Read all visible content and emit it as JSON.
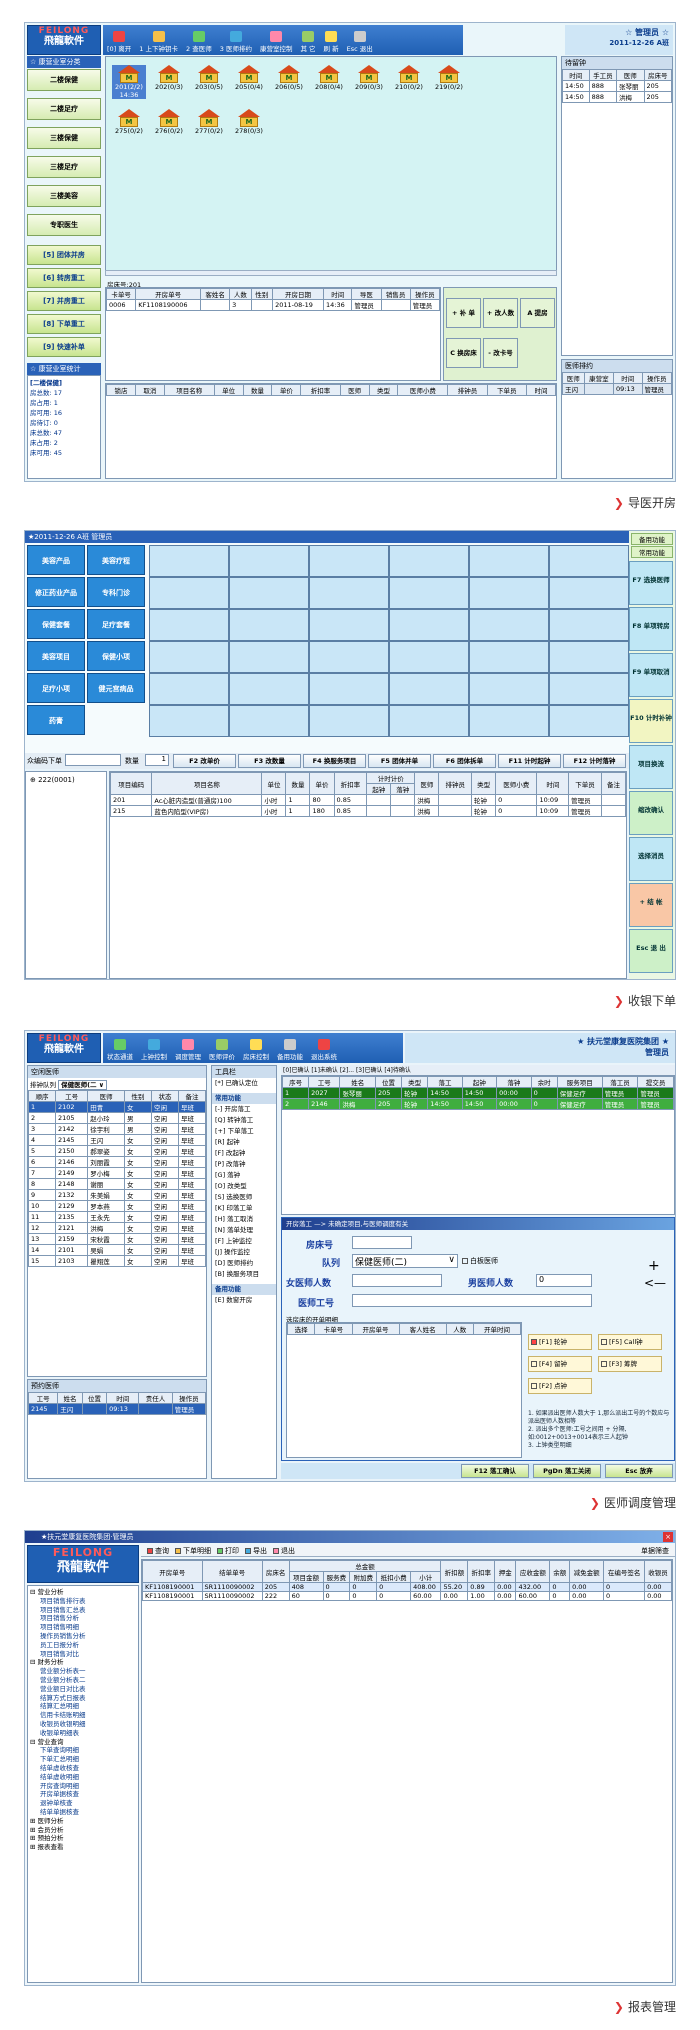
{
  "captions": {
    "p1": "导医开房",
    "p2": "收银下单",
    "p3": "医师调度管理",
    "p4": "报表管理"
  },
  "logo": {
    "en": "FEILONG",
    "cn": "飛龍軟件"
  },
  "p1": {
    "toolbar": [
      {
        "key": "[0]",
        "label": "离开"
      },
      {
        "key": "1",
        "label": "上下钟钥卡"
      },
      {
        "key": "2",
        "label": "查医师"
      },
      {
        "key": "3",
        "label": "医师排约"
      },
      {
        "key": "",
        "label": "康营室控制"
      },
      {
        "key": "",
        "label": "其 它"
      },
      {
        "key": "",
        "label": "刷 新"
      },
      {
        "key": "Esc",
        "label": "退出"
      }
    ],
    "user": "☆ 管理员 ☆",
    "date": "2011-12-26",
    "shift": "A班",
    "sidebar_title": "☆ 康营业室分类",
    "sidebar_items": [
      "二楼保健",
      "二楼足疗",
      "三楼保健",
      "三楼足疗",
      "三楼美容",
      "专职医生"
    ],
    "func_items": [
      "[5] 团体并房",
      "[6] 转房重工",
      "[7] 并房重工",
      "[8] 下单重工",
      "[9] 快速补单"
    ],
    "stats_title": "☆ 康营业室统计",
    "stats_group": "[二楼保健]",
    "stats": [
      {
        "k": "房总数",
        "v": "17"
      },
      {
        "k": "房占用",
        "v": "1"
      },
      {
        "k": "房可用",
        "v": "16"
      },
      {
        "k": "房待订",
        "v": "0"
      },
      {
        "k": "床总数",
        "v": "47"
      },
      {
        "k": "床占用",
        "v": "2"
      },
      {
        "k": "床可用",
        "v": "45"
      }
    ],
    "rooms": [
      {
        "no": "201",
        "cnt": "(2/2)",
        "t": "14:36"
      },
      {
        "no": "202",
        "cnt": "(0/3)"
      },
      {
        "no": "203",
        "cnt": "(0/5)"
      },
      {
        "no": "205",
        "cnt": "(0/4)"
      },
      {
        "no": "206",
        "cnt": "(0/5)"
      },
      {
        "no": "208",
        "cnt": "(0/4)"
      },
      {
        "no": "209",
        "cnt": "(0/3)"
      },
      {
        "no": "210",
        "cnt": "(0/2)"
      },
      {
        "no": "219",
        "cnt": "(0/2)"
      },
      {
        "no": "275",
        "cnt": "(0/2)"
      },
      {
        "no": "276",
        "cnt": "(0/2)"
      },
      {
        "no": "277",
        "cnt": "(0/2)"
      },
      {
        "no": "278",
        "cnt": "(0/3)"
      }
    ],
    "room_info": "房床号:201",
    "card_cols": [
      "卡单号",
      "开房单号",
      "客姓名",
      "人数",
      "性别",
      "开房日期",
      "时间",
      "导医",
      "销售员",
      "操作员"
    ],
    "card_row": [
      "0006",
      "KF1108190006",
      "",
      "3",
      "",
      "2011-08-19",
      "14:36",
      "管理员",
      "",
      "管理员"
    ],
    "card_btns": [
      "+ 补 单",
      "+ 改人数",
      "A 提房",
      "C 换房床",
      "- 改卡号"
    ],
    "item_cols": [
      "锁店",
      "取消",
      "项目名称",
      "单位",
      "数量",
      "单价",
      "折扣率",
      "医师",
      "类型",
      "医师小费",
      "排钟员",
      "下单员",
      "时间"
    ],
    "wait_title": "待留钟",
    "wait_cols": [
      "时间",
      "手工员",
      "医师",
      "房床号"
    ],
    "wait_rows": [
      [
        "14:50",
        "888",
        "张琴丽",
        "205"
      ],
      [
        "14:50",
        "888",
        "洪梅",
        "205"
      ]
    ],
    "doc_title": "医师排约",
    "doc_cols": [
      "医师",
      "康营室",
      "时间",
      "操作员"
    ],
    "doc_rows": [
      [
        "王闪",
        "",
        "09:13",
        "管理员"
      ]
    ]
  },
  "p2": {
    "header": "★2011-12-26 A班 管理员",
    "cats": [
      "美容产品",
      "美容疗程",
      "修正药业产品",
      "专科门诊",
      "保健套餐",
      "足疗套餐",
      "美容项目",
      "保健小项",
      "足疗小项",
      "健元宫病品",
      "药膏"
    ],
    "right_top": [
      "备用功能",
      "常用功能"
    ],
    "right_btns": [
      "F7 选换医师",
      "F8 单项转房",
      "F9 单项取消",
      "F10 计时补钟",
      "项目换流",
      "缩改确认",
      "选择消员",
      "+ 结 帐",
      "Esc 退 出"
    ],
    "qty_label": "数量",
    "qty": "1",
    "order_label": "众编码下单",
    "fkeys": [
      "F2 改单价",
      "F3 改数量",
      "F4 换服务项目",
      "F5 团体并单",
      "F6 团体拆单",
      "F11 计时起钟",
      "F12 计时落钟"
    ],
    "tree_root": "⊕ 222(0001)",
    "cols": [
      "项目编码",
      "项目名称",
      "单位",
      "数量",
      "单价",
      "折扣率",
      "起钟",
      "落钟",
      "医师",
      "排钟员",
      "类型",
      "医师小费",
      "时间",
      "下单员",
      "备注"
    ],
    "timing": "计时计价",
    "rows": [
      [
        "201",
        "Ac心脏内造型(普通房)100",
        "小时",
        "1",
        "80",
        "0.85",
        "",
        "",
        "洪梅",
        "",
        "轮钟",
        "0",
        "10:09",
        "管理员",
        ""
      ],
      [
        "215",
        "蓝色内陷型(VIP房)",
        "小时",
        "1",
        "180",
        "0.85",
        "",
        "",
        "洪梅",
        "",
        "轮钟",
        "0",
        "10:09",
        "管理员",
        ""
      ]
    ]
  },
  "p3": {
    "toolbar": [
      "状态通道",
      "上钟控制",
      "调度管理",
      "医师评价",
      "房床控制",
      "备用功能",
      "退出系统"
    ],
    "company": "★ 扶元堂康复医院集团 ★",
    "user": "管理员",
    "left_title": "空闲医师",
    "sort_label": "排钟队列",
    "queue": "保健医师(二 ∨",
    "left_cols": [
      "顺序",
      "工号",
      "医师",
      "性别",
      "状态",
      "备注"
    ],
    "left_rows": [
      [
        "1",
        "2102",
        "田青",
        "女",
        "空闲",
        "早班"
      ],
      [
        "2",
        "2105",
        "赵小玲",
        "男",
        "空闲",
        "早班"
      ],
      [
        "3",
        "2142",
        "徐宇利",
        "男",
        "空闲",
        "早班"
      ],
      [
        "4",
        "2145",
        "王闪",
        "女",
        "空闲",
        "早班"
      ],
      [
        "5",
        "2150",
        "郝翠姿",
        "女",
        "空闲",
        "早班"
      ],
      [
        "6",
        "2146",
        "刘丽霞",
        "女",
        "空闲",
        "早班"
      ],
      [
        "7",
        "2149",
        "罗小梅",
        "女",
        "空闲",
        "早班"
      ],
      [
        "8",
        "2148",
        "谢丽",
        "女",
        "空闲",
        "早班"
      ],
      [
        "9",
        "2132",
        "朱美娟",
        "女",
        "空闲",
        "早班"
      ],
      [
        "10",
        "2129",
        "罗本燕",
        "女",
        "空闲",
        "早班"
      ],
      [
        "11",
        "2135",
        "王永先",
        "女",
        "空闲",
        "早班"
      ],
      [
        "12",
        "2121",
        "洪梅",
        "女",
        "空闲",
        "早班"
      ],
      [
        "13",
        "2159",
        "宋秋霞",
        "女",
        "空闲",
        "早班"
      ],
      [
        "14",
        "2101",
        "吴娟",
        "女",
        "空闲",
        "早班"
      ],
      [
        "15",
        "2103",
        "瞿翔莲",
        "女",
        "空闲",
        "早班"
      ]
    ],
    "book_title": "预约医师",
    "book_cols": [
      "工号",
      "姓名",
      "位置",
      "时间",
      "责任人",
      "操作员"
    ],
    "book_rows": [
      [
        "2145",
        "王闪",
        "",
        "09:13",
        "",
        "管理员"
      ]
    ],
    "mid_title": "工具栏",
    "mid_items": [
      "[*] 已确认定位",
      "常用功能",
      "[-] 开房落工",
      "[Q] 转钟落工",
      "[+] 下单落工",
      "[R] 起钟",
      "[F] 改起钟",
      "[P] 改落钟",
      "[G] 落钟",
      "[O] 改类型",
      "[S] 选换医师",
      "[K] 印落工单",
      "[H] 落工取消",
      "[N] 落单处理",
      "[F] 上钟监控",
      "[J] 操作监控",
      "[D] 医师排约",
      "[B] 换服务项目",
      "备用功能",
      "[E] 数窗开房"
    ],
    "status_tabs": "[0]已确认  [1]未确认  [2]...  [3]已确认  [4]待确认",
    "busy_cols": [
      "序号",
      "工号",
      "姓名",
      "位置",
      "类型",
      "落工",
      "起钟",
      "落钟",
      "余时",
      "服务项目",
      "落工员",
      "提交员"
    ],
    "busy_rows": [
      [
        "1",
        "2027",
        "张琴丽",
        "205",
        "轮钟",
        "14:50",
        "14:50",
        "00:00",
        "0",
        "保健足疗",
        "管理员",
        "管理员"
      ],
      [
        "2",
        "2146",
        "洪梅",
        "205",
        "轮钟",
        "14:50",
        "14:50",
        "00:00",
        "0",
        "保健足疗",
        "管理员",
        "管理员"
      ]
    ],
    "dialog_title": "开房落工 —> 未确定项目,与医师调度有关",
    "room_label": "房床号",
    "queue_label": "队列",
    "queue_val": "保健医师(二)",
    "queue_opt": "白板医师",
    "female_label": "女医师人数",
    "male_label": "男医师人数",
    "male_val": "0",
    "worker_label": "医师工号",
    "list_title": "选房床的开单明细",
    "list_cols": [
      "选择",
      "卡单号",
      "开房单号",
      "客人姓名",
      "人数",
      "开单时间"
    ],
    "checks": [
      "[F1] 轮钟",
      "[F4] 留钟",
      "[F2] 点钟",
      "[F5] Call钟",
      "[F3] 筹牌"
    ],
    "notes": [
      "1. 如果派出医师人数大于 1,那么派出工号的个数应与派出医师人数相等",
      "2. 派出多个医师:工号之间用 + 分隔,如:0012+0013+0014表示三人起钟",
      "3. 上钟类型明细"
    ],
    "bottom_btns": [
      "F12 落工确认",
      "PgDn 落工关闭",
      "Esc 放弃"
    ]
  },
  "p4": {
    "title": "★扶元堂康复医院集团·管理员",
    "toolbar": [
      "查询",
      "下单明细",
      "打印",
      "导出",
      "退出"
    ],
    "filter": "单据筛查",
    "tree": [
      {
        "t": "⊟ 营业分析",
        "l": 0
      },
      {
        "t": "项目销售排行表",
        "l": 1
      },
      {
        "t": "项目销售汇总表",
        "l": 1
      },
      {
        "t": "项目销售分析",
        "l": 1
      },
      {
        "t": "项目销售明细",
        "l": 1
      },
      {
        "t": "操作员销售分析",
        "l": 1
      },
      {
        "t": "员工日报分析",
        "l": 1
      },
      {
        "t": "项目销售对比",
        "l": 1
      },
      {
        "t": "⊟ 财务分析",
        "l": 0
      },
      {
        "t": "营业额分析表一",
        "l": 1
      },
      {
        "t": "营业额分析表二",
        "l": 1
      },
      {
        "t": "营业额日对比表",
        "l": 1
      },
      {
        "t": "结算方式日报表",
        "l": 1
      },
      {
        "t": "结算汇总明细",
        "l": 1
      },
      {
        "t": "信用卡结账明细",
        "l": 1
      },
      {
        "t": "收银员收银明细",
        "l": 1
      },
      {
        "t": "收银单明细表",
        "l": 1
      },
      {
        "t": "⊟ 营业查询",
        "l": 0
      },
      {
        "t": "下单查询明细",
        "l": 1
      },
      {
        "t": "下单汇总明细",
        "l": 1
      },
      {
        "t": "结单虚收核查",
        "l": 1
      },
      {
        "t": "结单虚收明细",
        "l": 1
      },
      {
        "t": "开房查询明细",
        "l": 1
      },
      {
        "t": "开房单据核查",
        "l": 1
      },
      {
        "t": "退钟单核查",
        "l": 1
      },
      {
        "t": "结单单据核查",
        "l": 1
      },
      {
        "t": "⊞ 医师分析",
        "l": 0
      },
      {
        "t": "⊞ 会员分析",
        "l": 0
      },
      {
        "t": "⊞ 预拍分析",
        "l": 0
      },
      {
        "t": "⊞ 报表查看",
        "l": 0
      }
    ],
    "cols_top": [
      "开房单号",
      "结单单号",
      "房床名",
      "总金额",
      "",
      "",
      "",
      "",
      "折扣额",
      "折扣率",
      "押金",
      "应收金额",
      "余额",
      "减免金额",
      "在编号签名",
      "收银员"
    ],
    "cols_sub": [
      "项目金额",
      "服务费",
      "附加费",
      "抵扣小费",
      "小计"
    ],
    "rows": [
      [
        "KF1108190001",
        "SR1110090002",
        "205",
        "408",
        "0",
        "0",
        "0",
        "408.00",
        "55.20",
        "0.89",
        "0.00",
        "432.00",
        "0",
        "0.00",
        "0",
        "0.00"
      ],
      [
        "KF1108190001",
        "SR1110090002",
        "222",
        "60",
        "0",
        "0",
        "0",
        "60.00",
        "0.00",
        "1.00",
        "0.00",
        "60.00",
        "0",
        "0.00",
        "0",
        "0.00"
      ]
    ]
  }
}
